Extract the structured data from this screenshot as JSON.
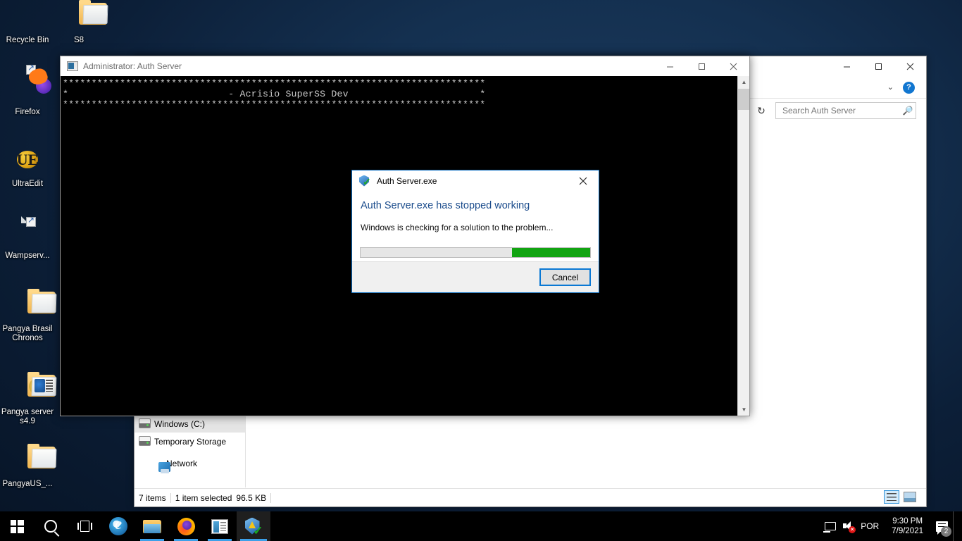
{
  "desktop": {
    "icons": [
      {
        "label": "Recycle Bin",
        "icon": "recycle-bin-icon",
        "type": "recycle"
      },
      {
        "label": "S8",
        "icon": "folder-icon",
        "type": "folder-content"
      },
      {
        "label": "Firefox",
        "icon": "firefox-icon",
        "type": "firefox"
      },
      {
        "label": "UltraEdit",
        "icon": "ultraedit-icon",
        "type": "ultraedit",
        "glyph": "UE"
      },
      {
        "label": "Wampserv...",
        "icon": "document-icon",
        "type": "document"
      },
      {
        "label": "Pangya Brasil Chronos",
        "icon": "folder-icon",
        "type": "folder"
      },
      {
        "label": "Pangya server s4.9",
        "icon": "folder-icon",
        "type": "folder-disc"
      },
      {
        "label": "PangyaUS_...",
        "icon": "folder-icon",
        "type": "folder"
      }
    ]
  },
  "console_window": {
    "title": "Administrator:  Auth Server",
    "icon": "console-icon",
    "minimize_label": "Minimize",
    "maximize_label": "Maximize",
    "close_label": "Close",
    "text_lines": [
      "**************************************************************************",
      "*                            - Acrisio SuperSS Dev                       *",
      "**************************************************************************"
    ]
  },
  "explorer_window": {
    "minimize_label": "Minimize",
    "maximize_label": "Maximize",
    "close_label": "Close",
    "ribbon_expand_label": "chevron-down",
    "help_label": "?",
    "refresh_label": "Refresh",
    "search": {
      "placeholder": "Search Auth Server",
      "value": ""
    },
    "nav_items": [
      {
        "label": "Windows (C:)",
        "icon": "drive-icon",
        "selected": true
      },
      {
        "label": "Temporary Storage",
        "icon": "drive-icon",
        "selected": false
      },
      {
        "label": "Network",
        "icon": "network-icon",
        "selected": false
      }
    ],
    "status": {
      "item_count": "7 items",
      "selection": "1 item selected",
      "size": "96.5 KB"
    },
    "view_buttons": [
      {
        "name": "details-view",
        "label": "Details view"
      },
      {
        "name": "large-icons-view",
        "label": "Large icons view"
      }
    ]
  },
  "error_dialog": {
    "title": "Auth Server.exe",
    "icon": "app-shield-icon",
    "close_label": "Close",
    "heading": "Auth Server.exe has stopped working",
    "message": "Windows is checking for a solution to the problem...",
    "progress_percent": 34,
    "progress_color": "#12a412",
    "cancel_label": "Cancel"
  },
  "taskbar": {
    "start_label": "Start",
    "search_label": "Search",
    "task_view_label": "Task View",
    "apps": [
      {
        "name": "internet-explorer",
        "label": "Internet Explorer",
        "running": false,
        "active": false
      },
      {
        "name": "file-explorer",
        "label": "File Explorer",
        "running": true,
        "active": false
      },
      {
        "name": "firefox",
        "label": "Firefox",
        "running": true,
        "active": false
      },
      {
        "name": "ultraedit",
        "label": "UltraEdit",
        "running": true,
        "active": false
      },
      {
        "name": "auth-server",
        "label": "Auth Server",
        "running": true,
        "active": true
      }
    ],
    "tray": {
      "monitor_label": "Display",
      "volume_label": "Volume muted",
      "language": "POR",
      "time": "9:30 PM",
      "date": "7/9/2021",
      "notification_count": "2"
    }
  },
  "colors": {
    "accent": "#0a78d4",
    "desktop_bg": "#143050",
    "progress_green": "#12a412",
    "dialog_heading": "#1b4c8c"
  }
}
